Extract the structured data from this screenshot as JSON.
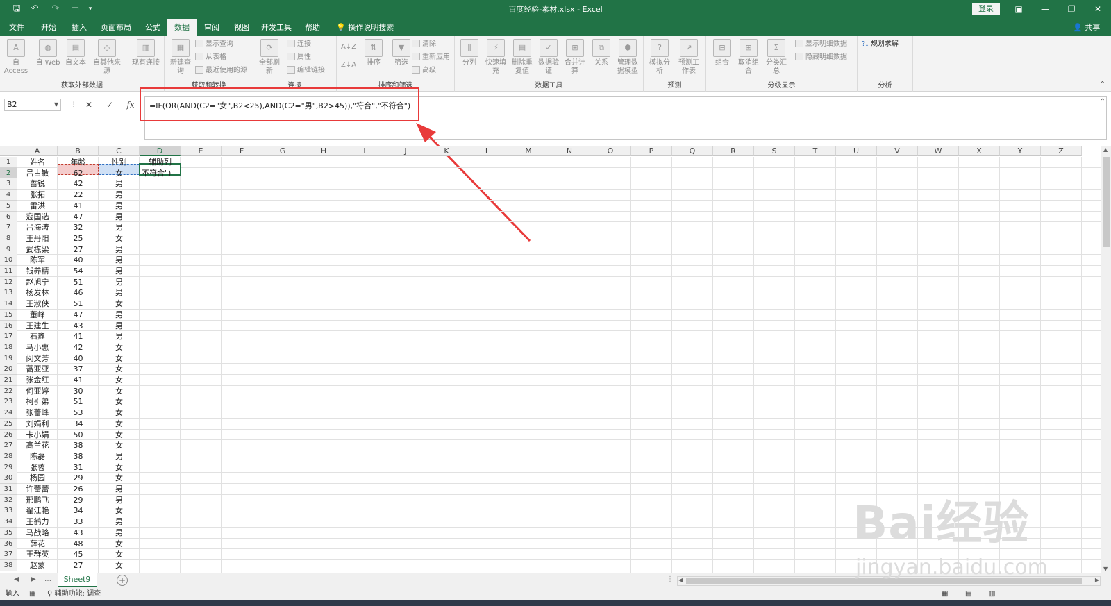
{
  "window": {
    "title": "百度经验-素材.xlsx  -  Excel",
    "login_label": "登录",
    "share_label": "共享"
  },
  "tabs": [
    "文件",
    "开始",
    "插入",
    "页面布局",
    "公式",
    "数据",
    "审阅",
    "视图",
    "开发工具",
    "帮助"
  ],
  "active_tab": "数据",
  "tell_me": "操作说明搜索",
  "ribbon": {
    "groups": [
      {
        "label": "获取外部数据",
        "buttons": [
          "自 Access",
          "自 Web",
          "自文本",
          "自其他来源",
          "现有连接"
        ]
      },
      {
        "label": "获取和转换",
        "buttons": [
          "新建查询"
        ],
        "small": [
          "显示查询",
          "从表格",
          "最近使用的源"
        ]
      },
      {
        "label": "连接",
        "buttons": [
          "全部刷新"
        ],
        "small": [
          "连接",
          "属性",
          "编辑链接"
        ]
      },
      {
        "label": "排序和筛选",
        "buttons": [
          "排序",
          "筛选"
        ],
        "small": [
          "清除",
          "重新应用",
          "高级"
        ]
      },
      {
        "label": "数据工具",
        "buttons": [
          "分列",
          "快速填充",
          "删除重复值",
          "数据验证",
          "合并计算",
          "关系",
          "管理数据模型"
        ]
      },
      {
        "label": "预测",
        "buttons": [
          "模拟分析",
          "预测工作表"
        ]
      },
      {
        "label": "分级显示",
        "buttons": [
          "组合",
          "取消组合",
          "分类汇总"
        ],
        "small": [
          "显示明细数据",
          "隐藏明细数据"
        ]
      },
      {
        "label": "分析",
        "small": [
          "规划求解"
        ]
      }
    ]
  },
  "formula_bar": {
    "name_box": "B2",
    "formula": "=IF(OR(AND(C2=\"女\",B2<25),AND(C2=\"男\",B2>45)),\"符合\",\"不符合\")"
  },
  "columns": [
    "A",
    "B",
    "C",
    "D",
    "E",
    "F",
    "G",
    "H",
    "I",
    "J",
    "K",
    "L",
    "M",
    "N",
    "O",
    "P",
    "Q",
    "R",
    "S",
    "T",
    "U",
    "V",
    "W",
    "X",
    "Y",
    "Z"
  ],
  "header_row": [
    "姓名",
    "年龄",
    "性别",
    "辅助列"
  ],
  "rows": [
    [
      "吕占敏",
      "62",
      "女"
    ],
    [
      "蔷锐",
      "42",
      "男"
    ],
    [
      "张拓",
      "22",
      "男"
    ],
    [
      "雷洪",
      "41",
      "男"
    ],
    [
      "寇国选",
      "47",
      "男"
    ],
    [
      "吕海涛",
      "32",
      "男"
    ],
    [
      "王丹阳",
      "25",
      "女"
    ],
    [
      "武栋梁",
      "27",
      "男"
    ],
    [
      "陈军",
      "40",
      "男"
    ],
    [
      "钱养精",
      "54",
      "男"
    ],
    [
      "赵旭宁",
      "51",
      "男"
    ],
    [
      "杨发林",
      "46",
      "男"
    ],
    [
      "王淑侠",
      "51",
      "女"
    ],
    [
      "董峰",
      "47",
      "男"
    ],
    [
      "王建生",
      "43",
      "男"
    ],
    [
      "石鑫",
      "41",
      "男"
    ],
    [
      "马小惠",
      "42",
      "女"
    ],
    [
      "闵文芳",
      "40",
      "女"
    ],
    [
      "蔷亚亚",
      "37",
      "女"
    ],
    [
      "张金红",
      "41",
      "女"
    ],
    [
      "何亚婷",
      "30",
      "女"
    ],
    [
      "柯引弟",
      "51",
      "女"
    ],
    [
      "张蕾峰",
      "53",
      "女"
    ],
    [
      "刘娟利",
      "34",
      "女"
    ],
    [
      "卡小娟",
      "50",
      "女"
    ],
    [
      "高兰花",
      "38",
      "女"
    ],
    [
      "陈磊",
      "38",
      "男"
    ],
    [
      "张蓉",
      "31",
      "女"
    ],
    [
      "杨园",
      "29",
      "女"
    ],
    [
      "许蕾蕾",
      "26",
      "男"
    ],
    [
      "邢鹏飞",
      "29",
      "男"
    ],
    [
      "翟江艳",
      "34",
      "女"
    ],
    [
      "王鹤力",
      "33",
      "男"
    ],
    [
      "马战略",
      "43",
      "男"
    ],
    [
      "薛花",
      "48",
      "女"
    ],
    [
      "王群英",
      "45",
      "女"
    ],
    [
      "赵蒙",
      "27",
      "女"
    ]
  ],
  "editing_cell_text": "不符合\")",
  "sheet_tab": "Sheet9",
  "status": {
    "mode": "输入",
    "accessibility": "辅助功能: 调查"
  },
  "watermark": {
    "main": "Bai经验",
    "sub": "jingyan.baidu.com"
  },
  "colors": {
    "excel_green": "#217346",
    "annotation_red": "#e83a3a"
  }
}
